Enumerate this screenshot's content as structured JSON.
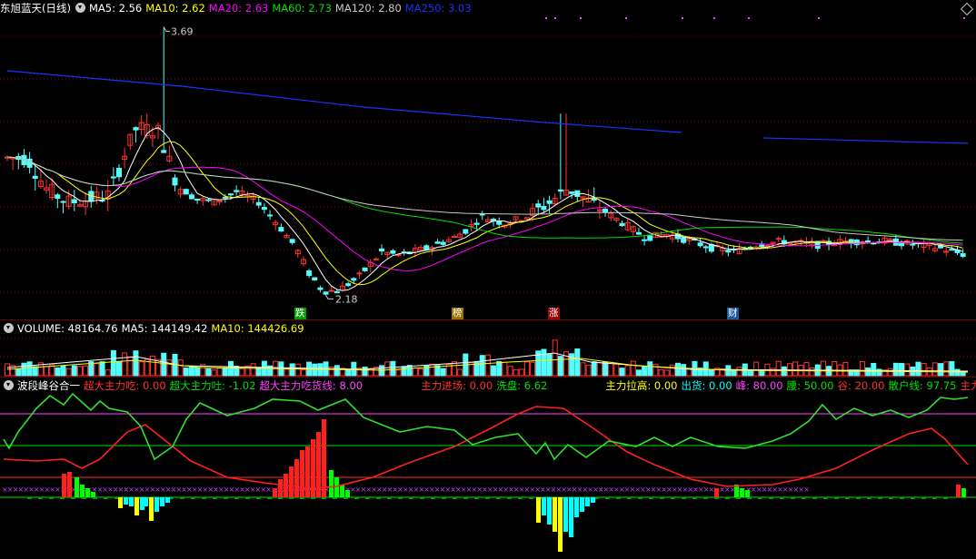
{
  "main": {
    "stock_name": "东旭蓝天(日线)",
    "ma": [
      {
        "label": "MA5: 2.56",
        "color": "#ffffff"
      },
      {
        "label": "MA10: 2.62",
        "color": "#ffff00"
      },
      {
        "label": "MA20: 2.63",
        "color": "#ff00ff"
      },
      {
        "label": "MA60: 2.73",
        "color": "#00e000"
      },
      {
        "label": "MA120: 2.80",
        "color": "#c8c8c8"
      },
      {
        "label": "MA250: 3.03",
        "color": "#1c30ff"
      }
    ],
    "high_label": "3.69",
    "low_label": "2.18",
    "price_range": [
      2.1,
      3.78
    ],
    "event_tags": [
      {
        "text": "跌",
        "bg": "#00a000",
        "color": "#ffffff"
      },
      {
        "text": "榜",
        "bg": "#a07000",
        "color": "#ffffff"
      },
      {
        "text": "涨",
        "bg": "#a00000",
        "color": "#ffffff"
      },
      {
        "text": "财",
        "bg": "#1e5aa0",
        "color": "#ffffff"
      }
    ]
  },
  "volume": {
    "label": "VOLUME: 48164.76",
    "ma5": "MA5: 144149.42",
    "ma10": "MA10: 144426.69"
  },
  "indicator": {
    "name": "波段峰谷合一",
    "items": [
      {
        "label": "超大主力吃: 0.00",
        "color": "#ff3030"
      },
      {
        "label": "超大主力吐: -1.02",
        "color": "#00e000"
      },
      {
        "label": "超大主力吃货线: 8.00",
        "color": "#ff40ff"
      },
      {
        "label": "主力进场: 0.00",
        "color": "#ff3030"
      },
      {
        "label": "洗盘: 6.62",
        "color": "#00e000"
      },
      {
        "label": "主力拉高: 0.00",
        "color": "#ffff00"
      },
      {
        "label": "出货: 0.00",
        "color": "#00ffff"
      },
      {
        "label": "峰: 80.00",
        "color": "#ff40ff"
      },
      {
        "label": "腰: 50.00",
        "color": "#00e000"
      },
      {
        "label": "谷: 20.00",
        "color": "#ff3030"
      },
      {
        "label": "散户线: 97.75",
        "color": "#00e000"
      },
      {
        "label": "主力",
        "color": "#ff3030"
      }
    ]
  },
  "colors": {
    "up": "#ff3232",
    "down": "#54fcfc",
    "grid": "#8a0000"
  }
}
